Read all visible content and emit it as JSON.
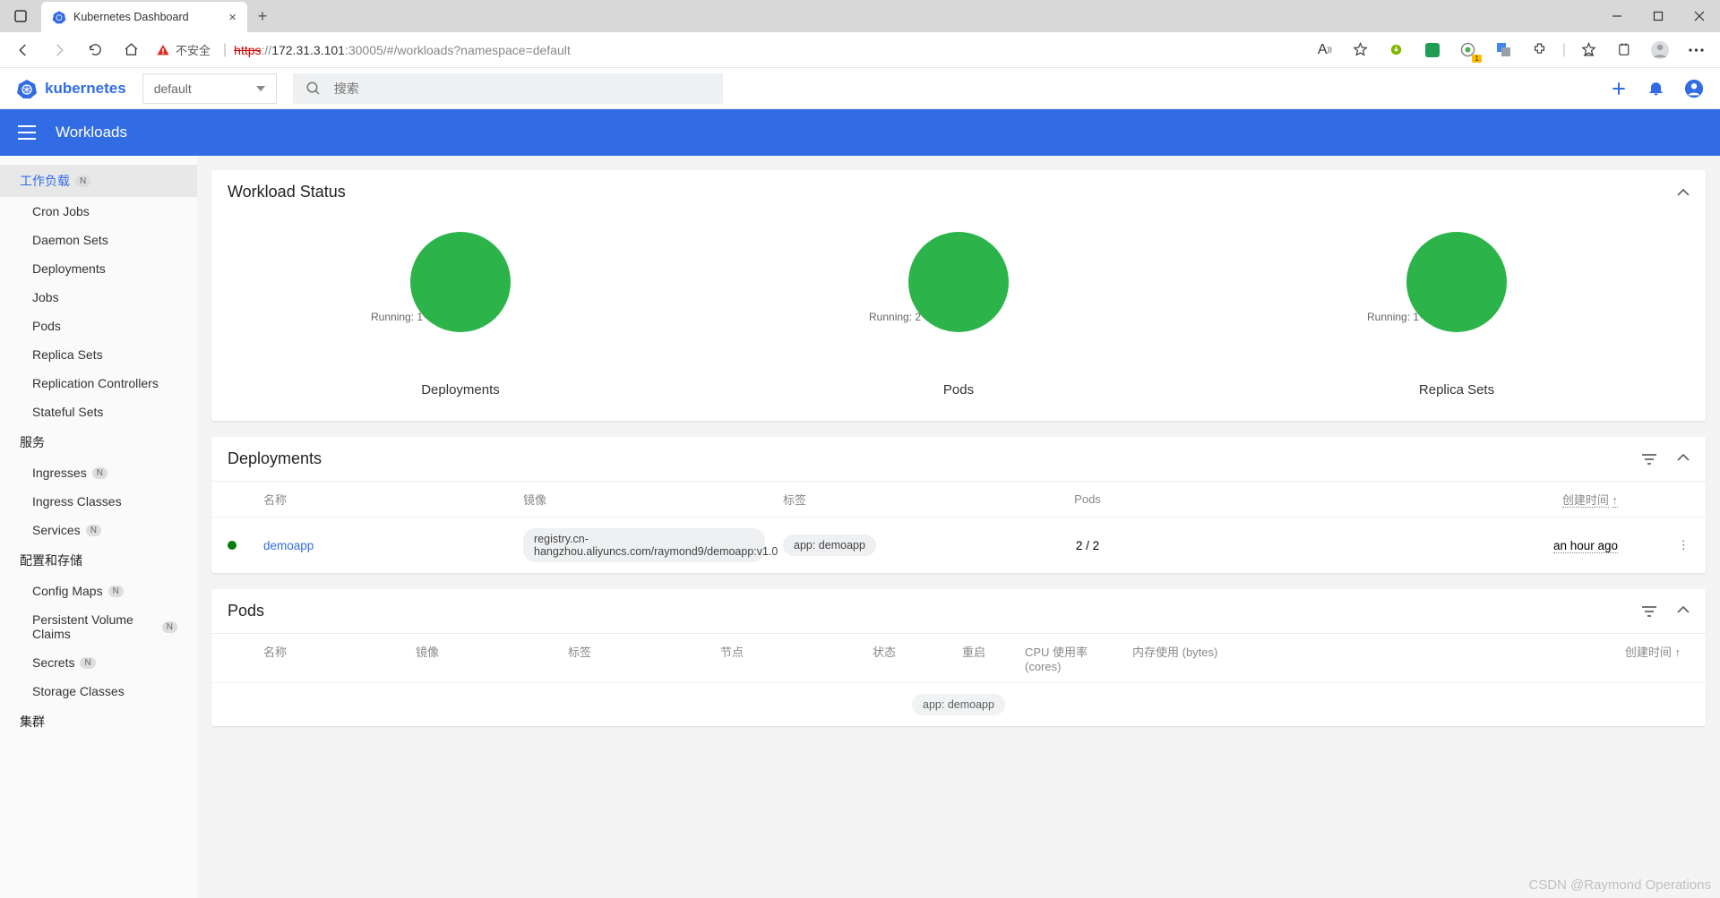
{
  "browser": {
    "tab_title": "Kubernetes Dashboard",
    "security_label": "不安全",
    "url_protocol": "https",
    "url_host": "172.31.3.101",
    "url_port_path": ":30005/#/workloads?namespace=default"
  },
  "header": {
    "brand": "kubernetes",
    "namespace": "default",
    "search_placeholder": "搜索"
  },
  "bluebar": {
    "breadcrumb": "Workloads"
  },
  "sidebar": {
    "workloads_label": "工作负载",
    "items_workloads": [
      "Cron Jobs",
      "Daemon Sets",
      "Deployments",
      "Jobs",
      "Pods",
      "Replica Sets",
      "Replication Controllers",
      "Stateful Sets"
    ],
    "services_label": "服务",
    "items_services": [
      {
        "label": "Ingresses",
        "n": true
      },
      {
        "label": "Ingress Classes",
        "n": false
      },
      {
        "label": "Services",
        "n": true
      }
    ],
    "config_label": "配置和存储",
    "items_config": [
      {
        "label": "Config Maps",
        "n": true
      },
      {
        "label": "Persistent Volume Claims",
        "n": true
      },
      {
        "label": "Secrets",
        "n": true
      },
      {
        "label": "Storage Classes",
        "n": false
      }
    ],
    "cluster_label": "集群"
  },
  "status_card": {
    "title": "Workload Status",
    "charts": [
      {
        "label": "Running: 1",
        "title": "Deployments"
      },
      {
        "label": "Running: 2",
        "title": "Pods"
      },
      {
        "label": "Running: 1",
        "title": "Replica Sets"
      }
    ]
  },
  "chart_data": [
    {
      "type": "pie",
      "title": "Deployments",
      "series": [
        {
          "name": "Running",
          "value": 1
        }
      ]
    },
    {
      "type": "pie",
      "title": "Pods",
      "series": [
        {
          "name": "Running",
          "value": 2
        }
      ]
    },
    {
      "type": "pie",
      "title": "Replica Sets",
      "series": [
        {
          "name": "Running",
          "value": 1
        }
      ]
    }
  ],
  "deployments": {
    "title": "Deployments",
    "columns": {
      "name": "名称",
      "image": "镜像",
      "labels": "标签",
      "pods": "Pods",
      "time": "创建时间"
    },
    "rows": [
      {
        "name": "demoapp",
        "image": "registry.cn-hangzhou.aliyuncs.com/raymond9/demoapp:v1.0",
        "label": "app: demoapp",
        "pods": "2 / 2",
        "time": "an hour ago"
      }
    ]
  },
  "pods": {
    "title": "Pods",
    "columns": {
      "name": "名称",
      "image": "镜像",
      "labels": "标签",
      "node": "节点",
      "status": "状态",
      "restarts": "重启",
      "cpu": "CPU 使用率 (cores)",
      "mem": "内存使用 (bytes)",
      "time": "创建时间"
    },
    "partial_label": "app: demoapp"
  },
  "watermark": "CSDN @Raymond Operations"
}
